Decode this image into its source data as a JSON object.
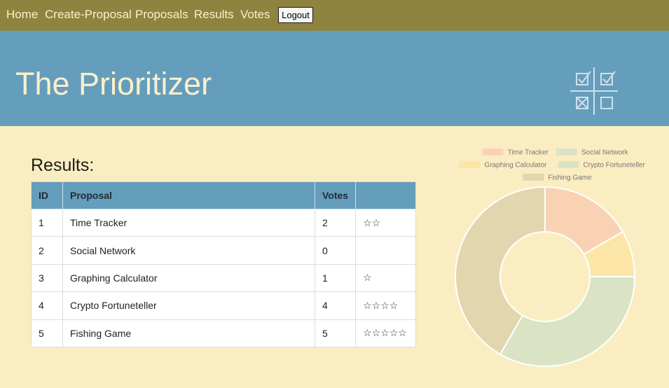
{
  "nav": {
    "links": [
      "Home",
      "Create-Proposal",
      "Proposals",
      "Results",
      "Votes"
    ],
    "logout_label": "Logout"
  },
  "banner": {
    "title": "The Prioritizer",
    "logo_icon": "checkbox-grid-icon"
  },
  "results": {
    "heading": "Results:",
    "columns": [
      "ID",
      "Proposal",
      "Votes",
      ""
    ],
    "rows": [
      {
        "id": "1",
        "proposal": "Time Tracker",
        "votes": "2",
        "stars": "☆☆"
      },
      {
        "id": "2",
        "proposal": "Social Network",
        "votes": "0",
        "stars": ""
      },
      {
        "id": "3",
        "proposal": "Graphing Calculator",
        "votes": "1",
        "stars": "☆"
      },
      {
        "id": "4",
        "proposal": "Crypto Fortuneteller",
        "votes": "4",
        "stars": "☆☆☆☆"
      },
      {
        "id": "5",
        "proposal": "Fishing Game",
        "votes": "5",
        "stars": "☆☆☆☆☆"
      }
    ]
  },
  "colors": {
    "nav_bg": "#8e843f",
    "banner_bg": "#659dbd",
    "page_bg": "#faedc1"
  },
  "chart_data": {
    "type": "pie",
    "categories": [
      "Time Tracker",
      "Social Network",
      "Graphing Calculator",
      "Crypto Fortuneteller",
      "Fishing Game"
    ],
    "values": [
      2,
      0,
      1,
      4,
      5
    ],
    "colors": [
      "#f9d2b4",
      "#dce3c6",
      "#fbe6a8",
      "#dae4c4",
      "#e2d6ae"
    ],
    "legend_position": "top",
    "doughnut": true
  }
}
